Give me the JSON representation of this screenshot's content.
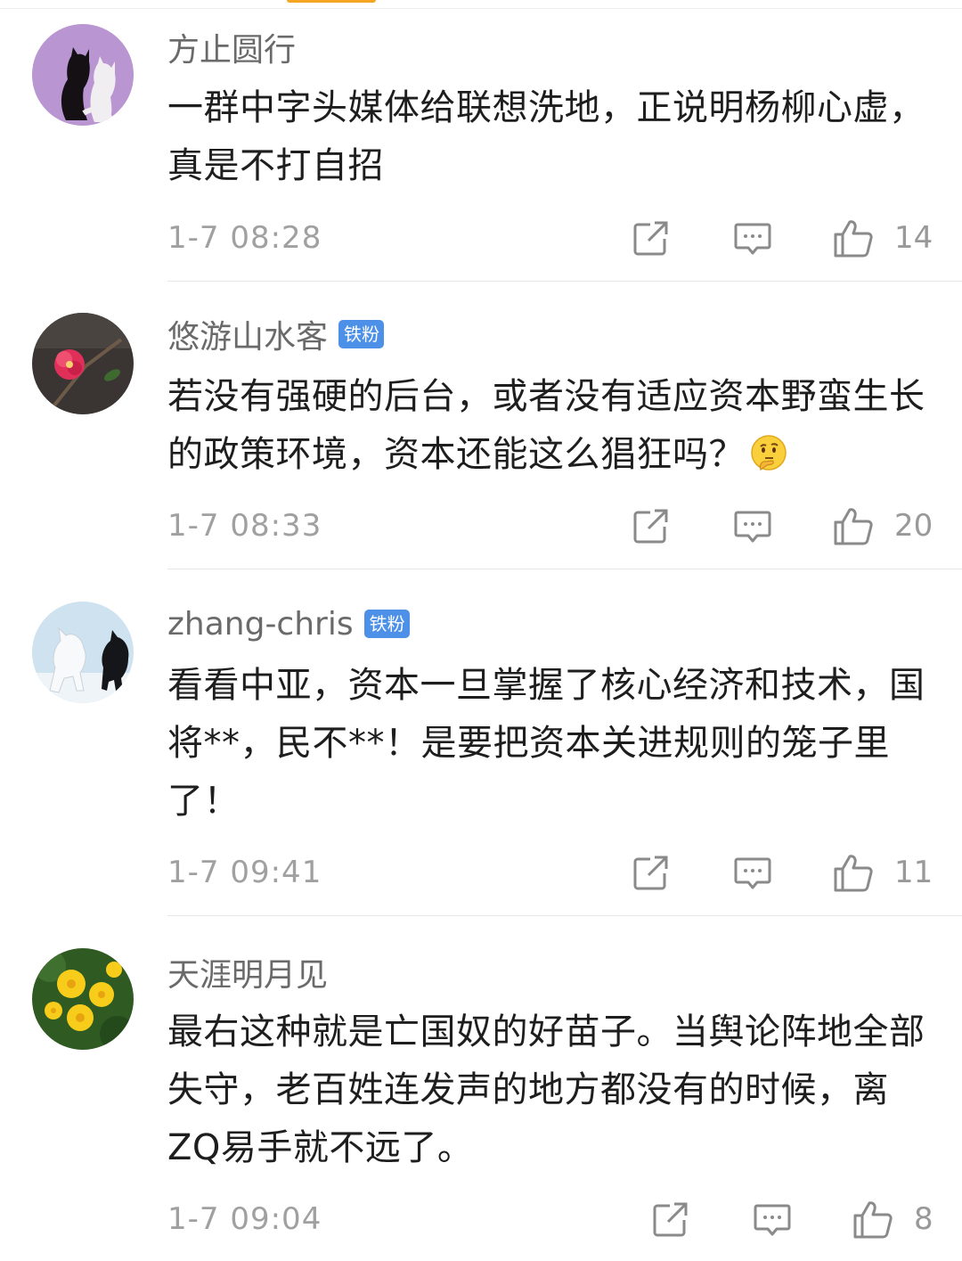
{
  "colors": {
    "badge_background": "#4d90e8",
    "username": "#6a6a6a",
    "timestamp": "#a0a0a0",
    "content": "#1e1e1e"
  },
  "comments": [
    {
      "username": "方止圆行",
      "badge": "",
      "content": "一群中字头媒体给联想洗地，正说明杨柳心虚，真是不打自招",
      "timestamp": "1-7 08:28",
      "likes": "14",
      "avatar_icon": "cats-avatar",
      "has_emoji": false
    },
    {
      "username": "悠游山水客",
      "badge": "铁粉",
      "content": "若没有强硬的后台，或者没有适应资本野蛮生长的政策环境，资本还能这么猖狂吗？",
      "timestamp": "1-7 08:33",
      "likes": "20",
      "avatar_icon": "flower-avatar",
      "has_emoji": true,
      "emoji_icon": "thinking-face-icon"
    },
    {
      "username": "zhang-chris",
      "badge": "铁粉",
      "content": "看看中亚，资本一旦掌握了核心经济和技术，国将**，民不**！是要把资本关进规则的笼子里了！",
      "timestamp": "1-7 09:41",
      "likes": "11",
      "avatar_icon": "horses-avatar",
      "has_emoji": false
    },
    {
      "username": "天涯明月见",
      "badge": "",
      "content": "最右这种就是亡国奴的好苗子。当舆论阵地全部失守，老百姓连发声的地方都没有的时候，离ZQ易手就不远了。",
      "timestamp": "1-7 09:04",
      "likes": "8",
      "avatar_icon": "daisies-avatar",
      "has_emoji": false
    }
  ]
}
